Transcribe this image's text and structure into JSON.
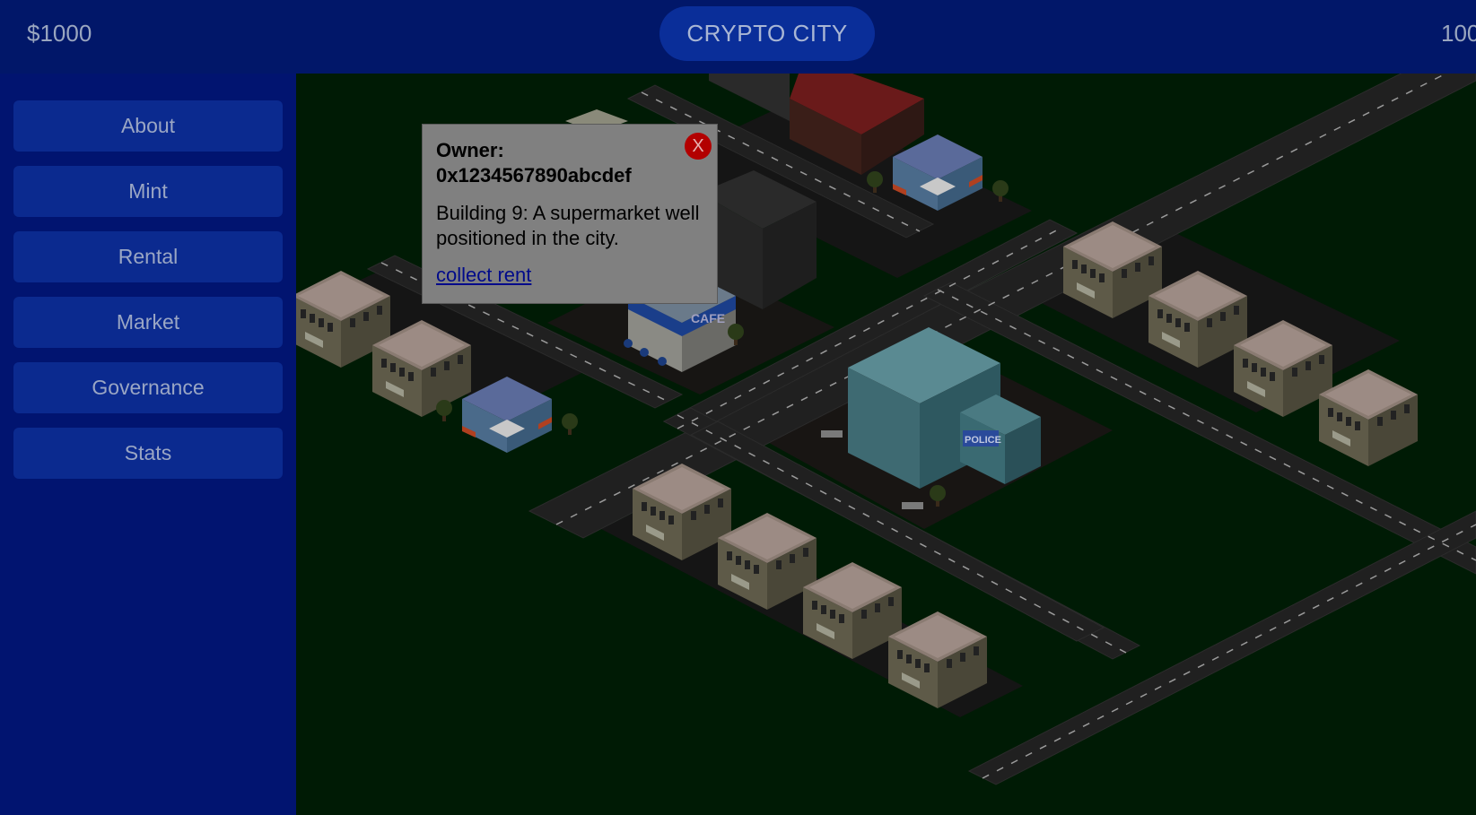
{
  "header": {
    "money": "$1000",
    "title": "CRYPTO CITY",
    "right_counter": "100"
  },
  "sidebar": {
    "items": [
      {
        "label": "About"
      },
      {
        "label": "Mint"
      },
      {
        "label": "Rental"
      },
      {
        "label": "Market"
      },
      {
        "label": "Governance"
      },
      {
        "label": "Stats"
      }
    ]
  },
  "popup": {
    "owner_label": "Owner:",
    "owner_address": "0x1234567890abcdef",
    "description": "Building 9: A supermarket well positioned in the city.",
    "link_label": "collect rent",
    "close_label": "X"
  },
  "map": {
    "cafe_sign": "CAFE",
    "police_sign": "POLICE"
  },
  "colors": {
    "header_bg": "#011769",
    "sidebar_bg": "#011470",
    "button_bg": "#0b2a8f",
    "grass": "#001b05",
    "road": "#1e1e1e",
    "close_red": "#b30000"
  }
}
